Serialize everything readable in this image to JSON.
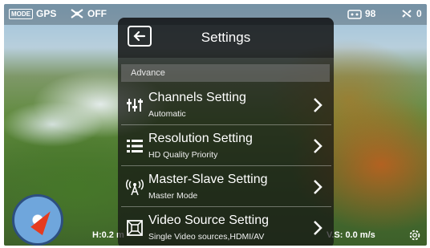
{
  "topbar": {
    "mode_label": "MODE",
    "gps_label": "GPS",
    "drone_status": "OFF",
    "signal_value": "98",
    "satellite_value": "0"
  },
  "overlay": {
    "height_label": "H:",
    "height_value": "0.2",
    "distance_partial": "m",
    "speed_label": "V.S:",
    "speed_value": "0.0 m/s"
  },
  "settings": {
    "title": "Settings",
    "section_label": "Advance",
    "rows": [
      {
        "title": "Channels Setting",
        "subtitle": "Automatic",
        "icon": "sliders-icon"
      },
      {
        "title": "Resolution Setting",
        "subtitle": "HD Quality Priority",
        "icon": "list-icon"
      },
      {
        "title": "Master-Slave Setting",
        "subtitle": "Master Mode",
        "icon": "antenna-icon"
      },
      {
        "title": "Video Source Setting",
        "subtitle": "Single Video sources,HDMI/AV",
        "icon": "video-source-icon"
      }
    ]
  },
  "colors": {
    "accent_red": "#e53b1f",
    "compass_ring": "#2d4f80",
    "compass_fill": "#6fa6dc"
  }
}
